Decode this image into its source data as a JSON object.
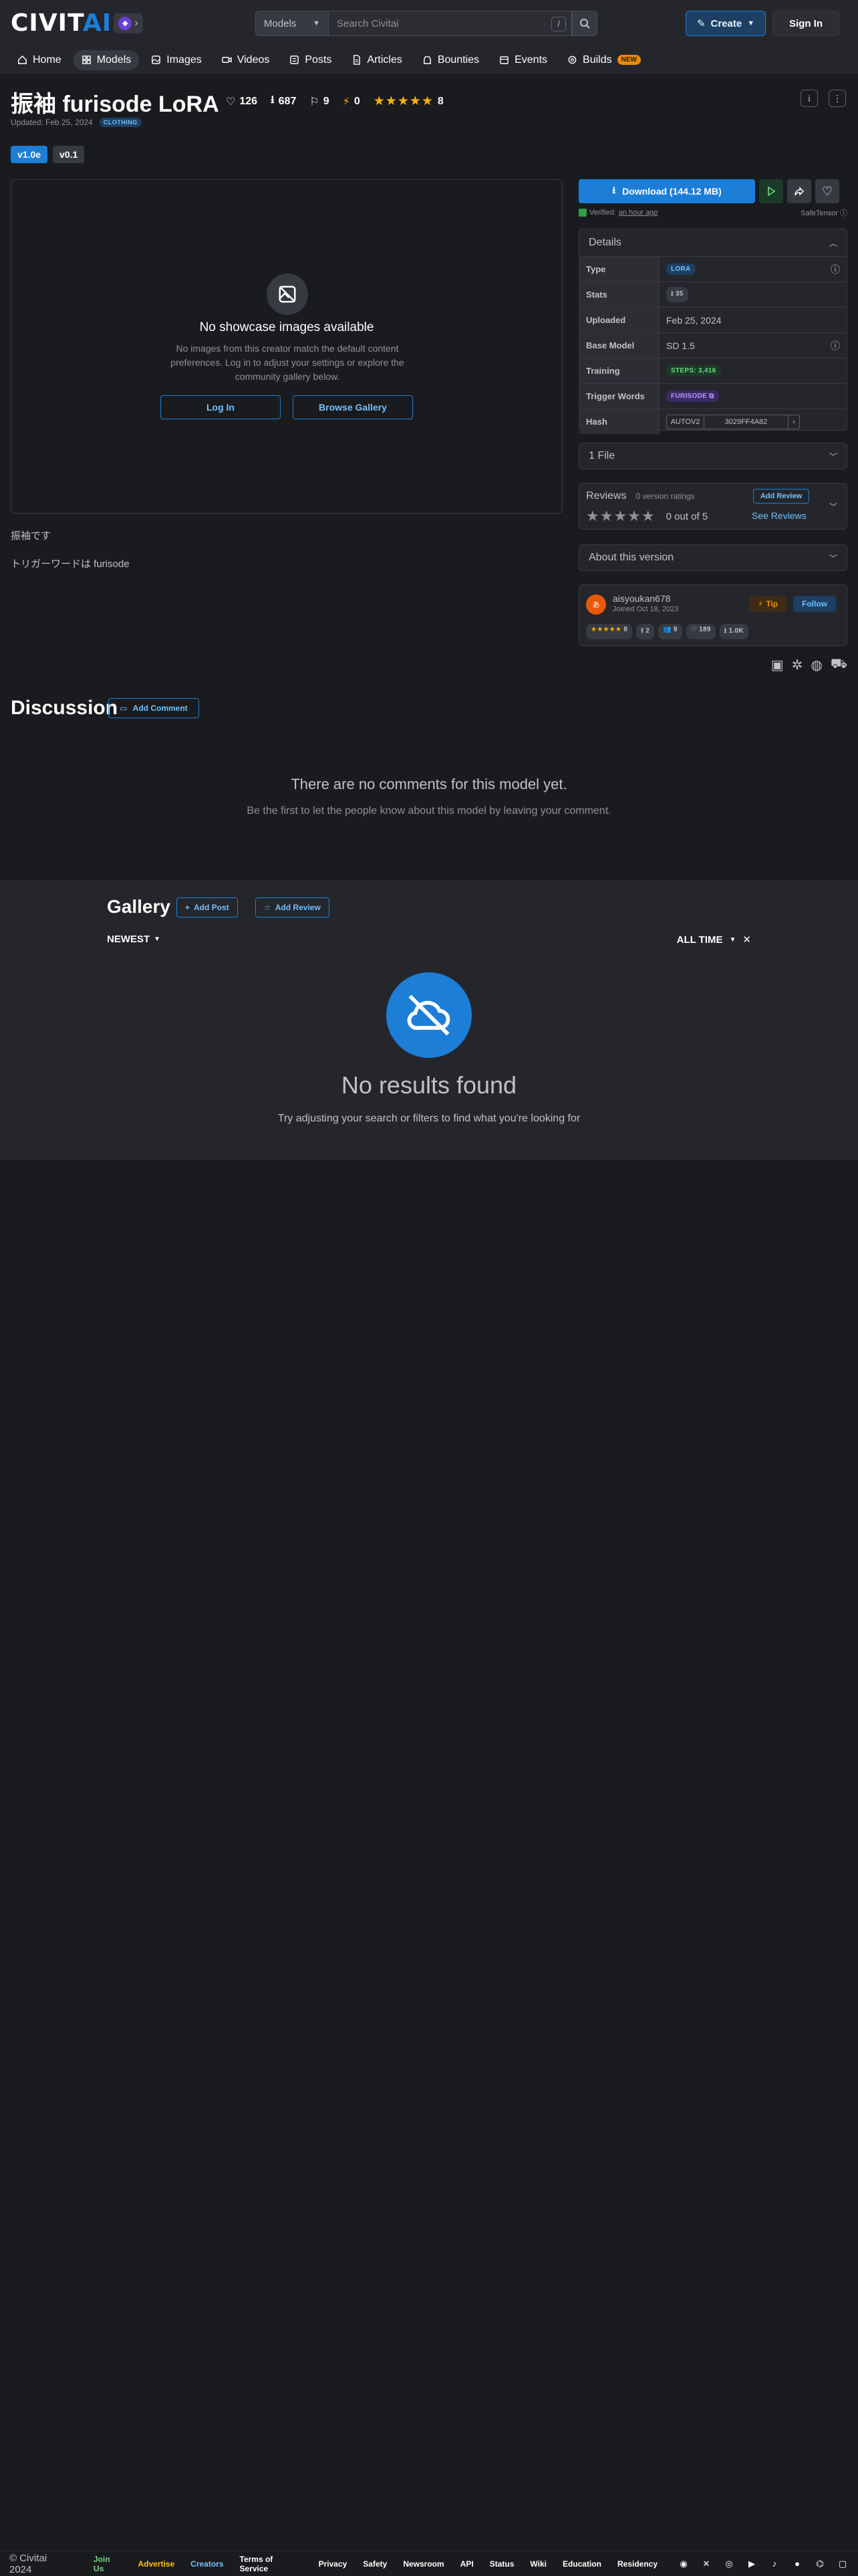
{
  "header": {
    "logo_main": "CIVIT",
    "logo_accent": "AI",
    "search_type": "Models",
    "search_placeholder": "Search Civitai",
    "search_shortcut": "/",
    "create_label": "Create",
    "signin_label": "Sign In"
  },
  "nav": {
    "items": [
      {
        "label": "Home",
        "icon": "home-icon"
      },
      {
        "label": "Models",
        "icon": "grid-icon"
      },
      {
        "label": "Images",
        "icon": "image-icon"
      },
      {
        "label": "Videos",
        "icon": "video-icon"
      },
      {
        "label": "Posts",
        "icon": "posts-icon"
      },
      {
        "label": "Articles",
        "icon": "article-icon"
      },
      {
        "label": "Bounties",
        "icon": "bounty-icon"
      },
      {
        "label": "Events",
        "icon": "calendar-icon"
      },
      {
        "label": "Builds",
        "icon": "builds-icon"
      }
    ],
    "builds_badge": "NEW"
  },
  "model": {
    "title": "振袖 furisode LoRA",
    "likes": "126",
    "downloads": "687",
    "bookmarks": "9",
    "buzz": "0",
    "rating_count": "8",
    "updated": "Updated: Feb 25, 2024",
    "category": "CLOTHING",
    "versions": [
      "v1.0e",
      "v0.1"
    ]
  },
  "showcase": {
    "title": "No showcase images available",
    "description": "No images from this creator match the default content preferences. Log in to adjust your settings or explore the community gallery below.",
    "login_label": "Log In",
    "gallery_label": "Browse Gallery"
  },
  "description": {
    "line1": "振袖です",
    "line2": "トリガーワードは furisode"
  },
  "download": {
    "label": "Download (144.12 MB)",
    "verified_prefix": "Verified:",
    "verified_time": "an hour ago",
    "safetensor": "SafeTensor"
  },
  "details": {
    "title": "Details",
    "rows": {
      "type_label": "Type",
      "type_value": "LORA",
      "stats_label": "Stats",
      "stats_value": "35",
      "uploaded_label": "Uploaded",
      "uploaded_value": "Feb 25, 2024",
      "base_label": "Base Model",
      "base_value": "SD 1.5",
      "training_label": "Training",
      "training_value": "STEPS: 3,416",
      "trigger_label": "Trigger Words",
      "trigger_value": "FURISODE",
      "hash_label": "Hash",
      "hash_type": "AUTOV2",
      "hash_value": "3029FF4A82"
    }
  },
  "files": {
    "label": "1 File"
  },
  "reviews": {
    "title": "Reviews",
    "ratings": "0 version ratings",
    "score": "0 out of 5",
    "add_label": "Add Review",
    "see_label": "See Reviews"
  },
  "about": {
    "label": "About this version"
  },
  "creator": {
    "name": "aisyoukan678",
    "joined": "Joined Oct 18, 2023",
    "tip_label": "Tip",
    "follow_label": "Follow",
    "rating": "8",
    "uploads": "2",
    "followers": "9",
    "likes": "189",
    "downloads": "1.0K"
  },
  "discussion": {
    "title": "Discussion",
    "add_label": "Add Comment",
    "empty_title": "There are no comments for this model yet.",
    "empty_sub": "Be the first to let the people know about this model by leaving your comment."
  },
  "gallery": {
    "title": "Gallery",
    "add_post": "Add Post",
    "add_review": "Add Review",
    "sort": "NEWEST",
    "period": "ALL TIME",
    "empty_title": "No results found",
    "empty_sub": "Try adjusting your search or filters to find what you're looking for"
  },
  "footer": {
    "copyright": "© Civitai 2024",
    "links": [
      "Join Us",
      "Advertise",
      "Creators",
      "Terms of Service",
      "Privacy",
      "Safety",
      "Newsroom",
      "API",
      "Status",
      "Wiki",
      "Education",
      "Residency"
    ]
  },
  "colors": {
    "background": "#1a1b1e",
    "surface": "#25262b",
    "accent": "#1c7ed6",
    "star": "#fab005"
  }
}
